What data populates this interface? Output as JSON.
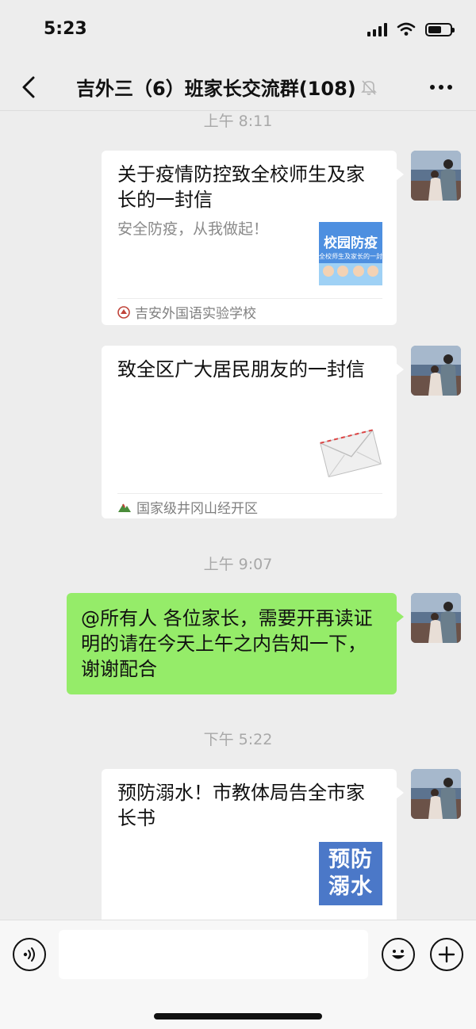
{
  "status_bar": {
    "time": "5:23",
    "battery_level": 0.62
  },
  "header": {
    "title": "吉外三（6）班家长交流群(108)",
    "back_icon": "chevron-left-icon",
    "mute_icon": "bell-off-icon",
    "more_icon": "more-icon"
  },
  "messages": [
    {
      "type": "timestamp",
      "text": "上午 8:11"
    },
    {
      "type": "link_card",
      "title": "关于疫情防控致全校师生及家长的一封信",
      "description": "安全防疫，从我做起！",
      "thumb_text": "校园防疫",
      "thumb_subtext": "全校师生及家长的一封",
      "source": "吉安外国语实验学校"
    },
    {
      "type": "link_card",
      "title": "致全区广大居民朋友的一封信",
      "description": "",
      "thumb_icon": "envelope-icon",
      "source": "国家级井冈山经开区"
    },
    {
      "type": "timestamp",
      "text": "上午 9:07"
    },
    {
      "type": "text",
      "text": "@所有人 各位家长，需要开再读证明的请在今天上午之内告知一下，谢谢配合"
    },
    {
      "type": "timestamp",
      "text": "下午 5:22"
    },
    {
      "type": "link_card",
      "title": "预防溺水！市教体局告全市家长书",
      "description": "",
      "thumb_text": "预防溺水"
    }
  ],
  "input_bar": {
    "voice_icon": "voice-icon",
    "emoji_icon": "emoji-icon",
    "plus_icon": "plus-icon",
    "input_value": ""
  },
  "colors": {
    "background": "#ededed",
    "my_bubble": "#95ec69",
    "card": "#ffffff",
    "timestamp": "#a8a8a8"
  }
}
